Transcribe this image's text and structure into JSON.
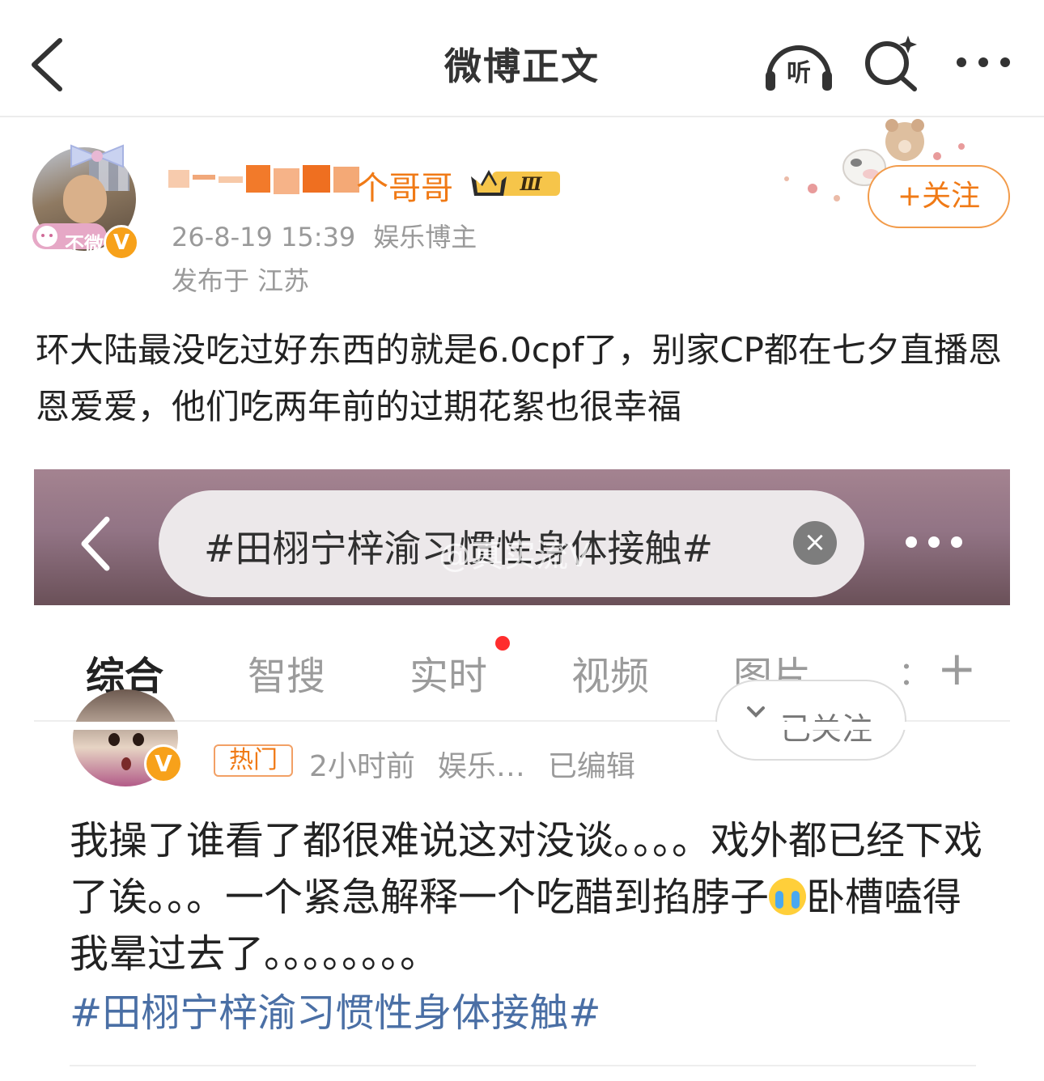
{
  "nav": {
    "title": "微博正文",
    "listen_label": "听",
    "icons": [
      "back-arrow-icon",
      "headphones-listen-icon",
      "search-sparkle-icon",
      "more-dots-icon"
    ]
  },
  "post": {
    "username_visible": "个哥哥",
    "rank_badge": "Ⅲ",
    "avatar_frame_text": "不微",
    "verified_mark": "V",
    "time": "26-8-19 15:39",
    "role": "娱乐博主",
    "location": "发布于 江苏",
    "follow_label": "+关注",
    "text": "环大陆最没吃过好东西的就是6.0cpf了，别家CP都在七夕直播恩恩爱爱，他们吃两年前的过期花絮也很幸福"
  },
  "embed": {
    "search_query": "#田栩宁梓渝习惯性身体接触#",
    "clear_icon": "×",
    "watermark": "@真实流V",
    "tabs": [
      {
        "label": "综合",
        "active": true
      },
      {
        "label": "智搜",
        "active": false
      },
      {
        "label": "实时",
        "active": false,
        "dot": true
      },
      {
        "label": "视频",
        "active": false
      },
      {
        "label": "图片",
        "active": false
      }
    ],
    "tab_cut_label": "：",
    "tab_add": "+",
    "reply": {
      "followed_label": "已关注",
      "verified_mark": "V",
      "hot_tag": "热门",
      "time": "2小时前",
      "category": "娱乐…",
      "edited": "已编辑",
      "text_part1": "我操了谁看了都很难说这对没谈。。。。戏外都已经下戏了诶。。。一个紧急解释一个吃醋到掐脖子",
      "text_part2": "卧槽嗑得我晕过去了。。。。。。。。",
      "topic": "#田栩宁梓渝习惯性身体接触#"
    }
  },
  "colors": {
    "accent_orange": "#f07a16",
    "topic_blue": "#4a6fa5",
    "meta_gray": "#9a9a9a",
    "tab_active_underline": "#f4a21e"
  }
}
